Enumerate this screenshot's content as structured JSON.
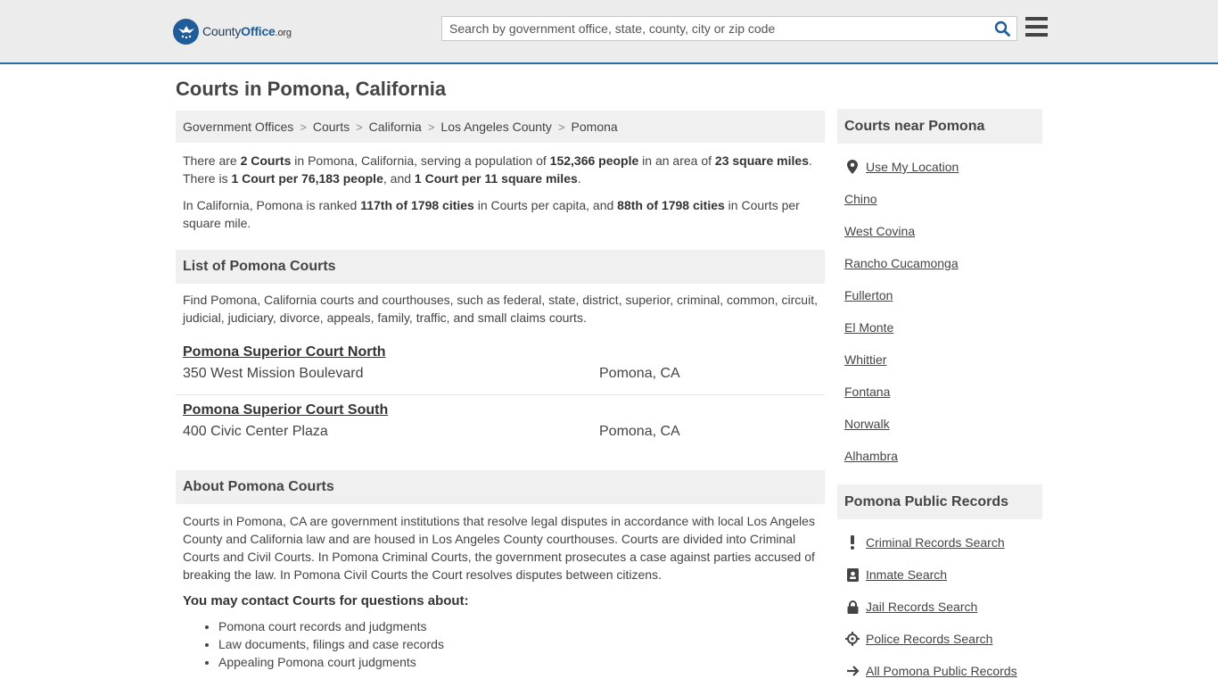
{
  "header": {
    "logo": {
      "part1": "County",
      "part2": "Office",
      "part3": ".org"
    },
    "search_placeholder": "Search by government office, state, county, city or zip code"
  },
  "page_title": "Courts in Pomona, California",
  "breadcrumb": [
    "Government Offices",
    "Courts",
    "California",
    "Los Angeles County",
    "Pomona"
  ],
  "stats": {
    "s1": "There are ",
    "b1": "2 Courts",
    "s2": " in Pomona, California, serving a population of ",
    "b2": "152,366 people",
    "s3": " in an area of ",
    "b3": "23 square miles",
    "s4": ". There is ",
    "b4": "1 Court per 76,183 people",
    "s5": ", and ",
    "b5": "1 Court per 11 square miles",
    "s6": "."
  },
  "ranking": {
    "s1": "In California, Pomona is ranked ",
    "b1": "117th of 1798 cities",
    "s2": " in Courts per capita, and ",
    "b2": "88th of 1798 cities",
    "s3": " in Courts per square mile."
  },
  "list_section": {
    "heading": "List of Pomona Courts",
    "intro": "Find Pomona, California courts and courthouses, such as federal, state, district, superior, criminal, common, circuit, judicial, judiciary, divorce, appeals, family, traffic, and small claims courts.",
    "courts": [
      {
        "name": "Pomona Superior Court North",
        "address": "350 West Mission Boulevard",
        "city": "Pomona, CA"
      },
      {
        "name": "Pomona Superior Court South",
        "address": "400 Civic Center Plaza",
        "city": "Pomona, CA"
      }
    ]
  },
  "about_section": {
    "heading": "About Pomona Courts",
    "body": "Courts in Pomona, CA are government institutions that resolve legal disputes in accordance with local Los Angeles County and California law and are housed in Los Angeles County courthouses. Courts are divided into Criminal Courts and Civil Courts. In Pomona Criminal Courts, the government prosecutes a case against parties accused of breaking the law. In Pomona Civil Courts the Court resolves disputes between citizens.",
    "contact_heading": "You may contact Courts for questions about:",
    "topics": [
      "Pomona court records and judgments",
      "Law documents, filings and case records",
      "Appealing Pomona court judgments"
    ]
  },
  "sidebar": {
    "nearby_heading": "Courts near Pomona",
    "use_location": "Use My Location",
    "nearby": [
      "Chino",
      "West Covina",
      "Rancho Cucamonga",
      "Fullerton",
      "El Monte",
      "Whittier",
      "Fontana",
      "Norwalk",
      "Alhambra"
    ],
    "records_heading": "Pomona Public Records",
    "records": [
      {
        "label": "Criminal Records Search",
        "icon": "exclamation-icon"
      },
      {
        "label": "Inmate Search",
        "icon": "id-badge-icon"
      },
      {
        "label": "Jail Records Search",
        "icon": "lock-icon"
      },
      {
        "label": "Police Records Search",
        "icon": "crosshair-icon"
      },
      {
        "label": "All Pomona Public Records",
        "icon": "arrow-right-icon"
      }
    ]
  }
}
